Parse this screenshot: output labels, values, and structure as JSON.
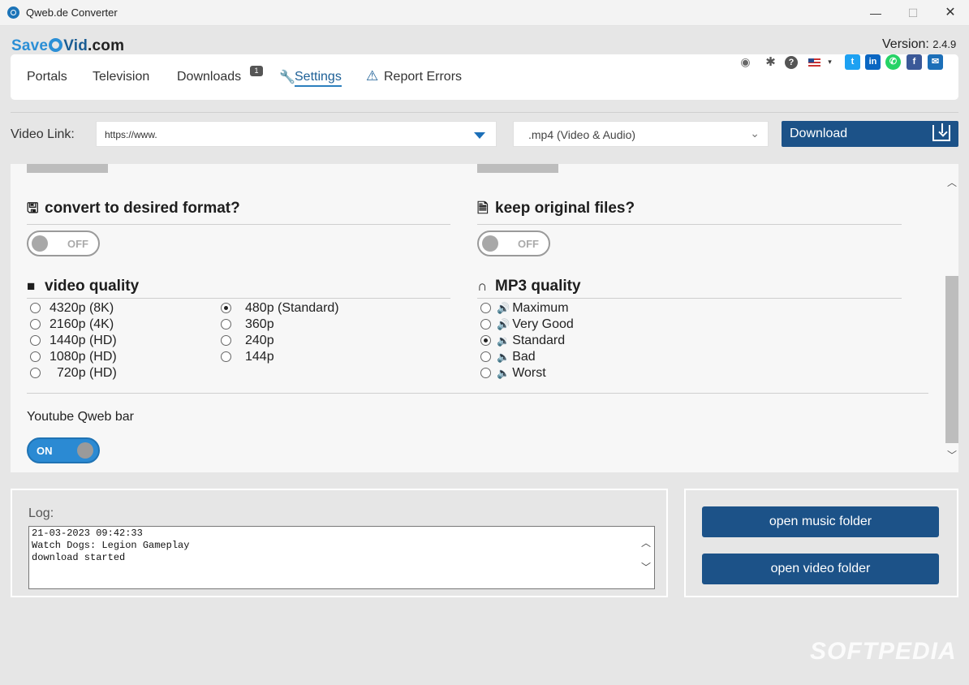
{
  "window": {
    "title": "Qweb.de Converter",
    "minimize": "—",
    "maximize": "☐",
    "close": "✕"
  },
  "brand": {
    "logo_part1": "Save",
    "logo_part2": "Vid",
    "logo_part3": ".com",
    "version_label": "Version:",
    "version_number": "2.4.9"
  },
  "nav": {
    "portals": "Portals",
    "television": "Television",
    "downloads": "Downloads",
    "downloads_badge": "1",
    "settings": "Settings",
    "report_errors": "Report Errors",
    "icons": [
      "eye-slash-icon",
      "bug-icon",
      "help-icon",
      "us-flag-icon",
      "twitter-icon",
      "linkedin-icon",
      "whatsapp-icon",
      "facebook-icon",
      "email-icon"
    ]
  },
  "link_row": {
    "label": "Video Link:",
    "url_value": "https://www.",
    "format_value": ".mp4 (Video & Audio)",
    "download_label": "Download"
  },
  "settings": {
    "convert": {
      "title": "convert to desired format?",
      "state": "OFF"
    },
    "keep": {
      "title": "keep original files?",
      "state": "OFF"
    },
    "video_quality": {
      "title": "video quality",
      "options": [
        "4320p (8K)",
        "2160p (4K)",
        "1440p (HD)",
        "1080p (HD)",
        "720p (HD)",
        "480p (Standard)",
        "360p",
        "240p",
        "144p"
      ],
      "selected": "480p (Standard)"
    },
    "mp3_quality": {
      "title": "MP3 quality",
      "options": [
        "Maximum",
        "Very Good",
        "Standard",
        "Bad",
        "Worst"
      ],
      "selected": "Standard"
    },
    "youtube_bar": {
      "label": "Youtube Qweb bar",
      "state": "ON"
    }
  },
  "log": {
    "label": "Log:",
    "lines": [
      "21-03-2023 09:42:33",
      "Watch Dogs: Legion Gameplay",
      "download started"
    ]
  },
  "folders": {
    "music": "open music folder",
    "video": "open video folder"
  },
  "watermark": "SOFTPEDIA",
  "colors": {
    "accent": "#1c5288",
    "link_blue": "#2b8fd6",
    "toggle_on": "#2b8ad3"
  }
}
